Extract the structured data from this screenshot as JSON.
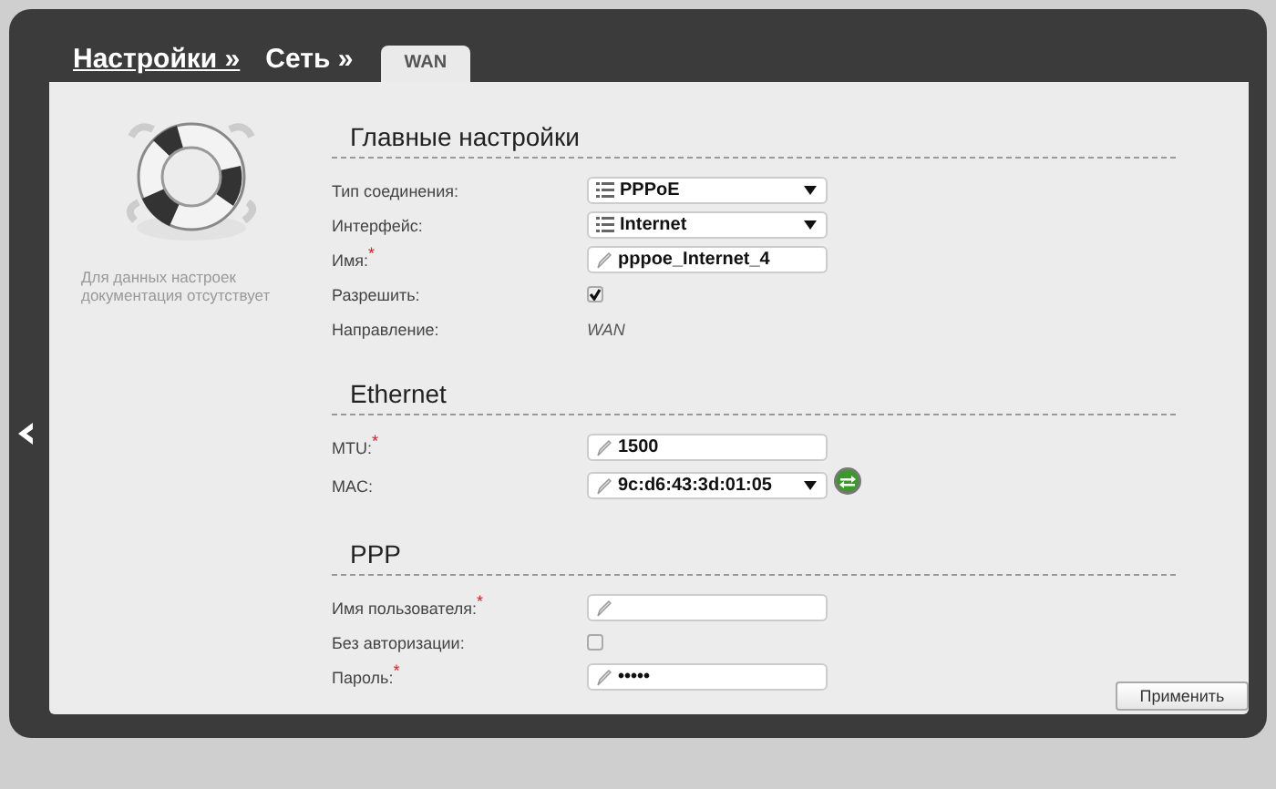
{
  "breadcrumbs": [
    {
      "label": "Настройки »",
      "link": true
    },
    {
      "label": "Сеть »",
      "link": false
    }
  ],
  "tabs": [
    {
      "label": "WAN",
      "selected": true
    }
  ],
  "sidebar": {
    "note": "Для данных настроек документация отсутствует"
  },
  "sections": [
    {
      "title": "Главные настройки",
      "fields": [
        {
          "kind": "select",
          "label": "Тип соединения:",
          "value": "PPPoE"
        },
        {
          "kind": "select",
          "label": "Интерфейс:",
          "value": "Internet"
        },
        {
          "kind": "text",
          "label": "Имя:",
          "required_mark": "*",
          "value": "pppoe_Internet_4"
        },
        {
          "kind": "checkbox",
          "label": "Разрешить:",
          "checked": true
        },
        {
          "kind": "static",
          "label": "Направление:",
          "value": "WAN"
        }
      ]
    },
    {
      "title": "Ethernet",
      "fields": [
        {
          "kind": "text",
          "label": "MTU:",
          "required_mark": "*",
          "value": "1500"
        },
        {
          "kind": "combo",
          "label": "MAC:",
          "value": "9c:d6:43:3d:01:05"
        }
      ]
    },
    {
      "title": "PPP",
      "fields": [
        {
          "kind": "text",
          "label": "Имя пользователя:",
          "required_mark": "*"
        },
        {
          "kind": "checkbox",
          "label": "Без авторизации:",
          "checked": false
        },
        {
          "kind": "text",
          "label": "Пароль:",
          "required_mark": "*",
          "value": "•••••"
        }
      ]
    }
  ],
  "buttons": [
    {
      "label": "Применить"
    }
  ]
}
